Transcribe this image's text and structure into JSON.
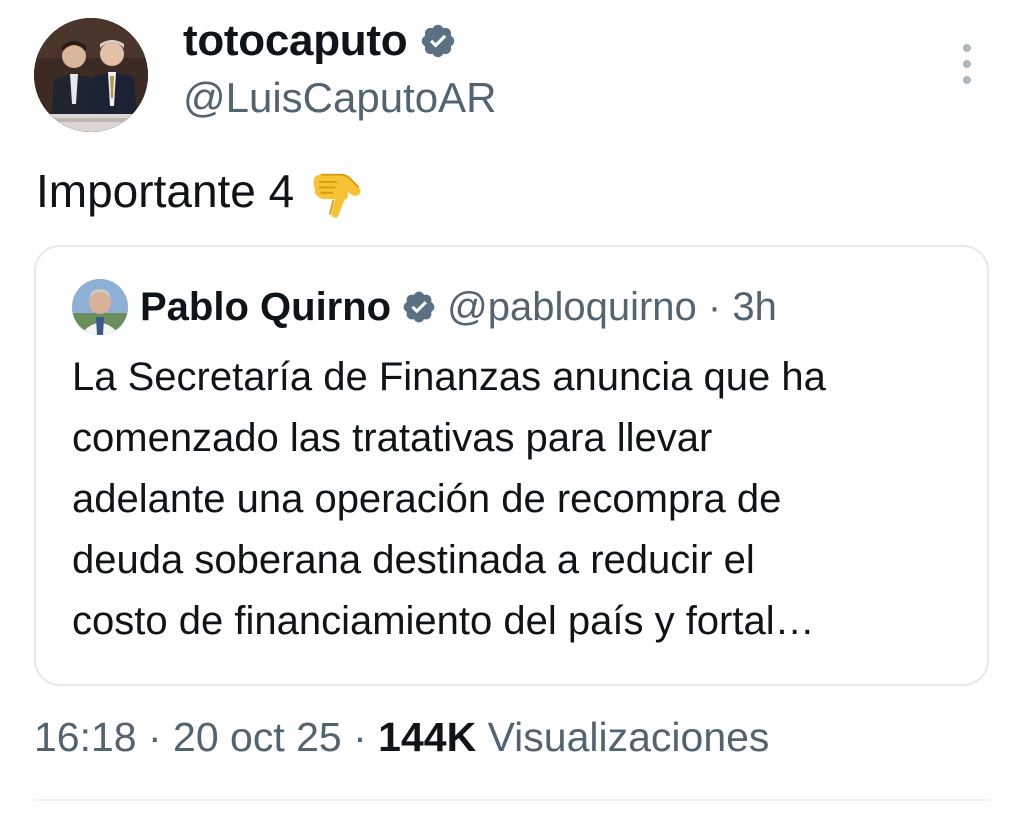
{
  "author": {
    "display_name": "totocaputo",
    "handle": "@LuisCaputoAR",
    "verified": true,
    "badge_color": "#5b7083"
  },
  "tweet": {
    "text": "Importante 4",
    "emoji_icon": "backhand-index-pointing-down-icon"
  },
  "quoted": {
    "display_name": "Pablo Quirno",
    "verified": true,
    "handle_time": "@pabloquirno · 3h",
    "lines": [
      "La Secretaría de Finanzas anuncia que ha",
      "comenzado las tratativas para  llevar",
      "adelante una operación de recompra de",
      "deuda soberana destinada a reducir el",
      "costo de financiamiento del país y fortal…"
    ]
  },
  "meta": {
    "time_date": "16:18 · 20 oct 25 · ",
    "views_count": "144K",
    "views_label": " Visualizaciones"
  },
  "colors": {
    "text": "#0f1419",
    "secondary": "#536471",
    "border": "#e4e9ed"
  }
}
